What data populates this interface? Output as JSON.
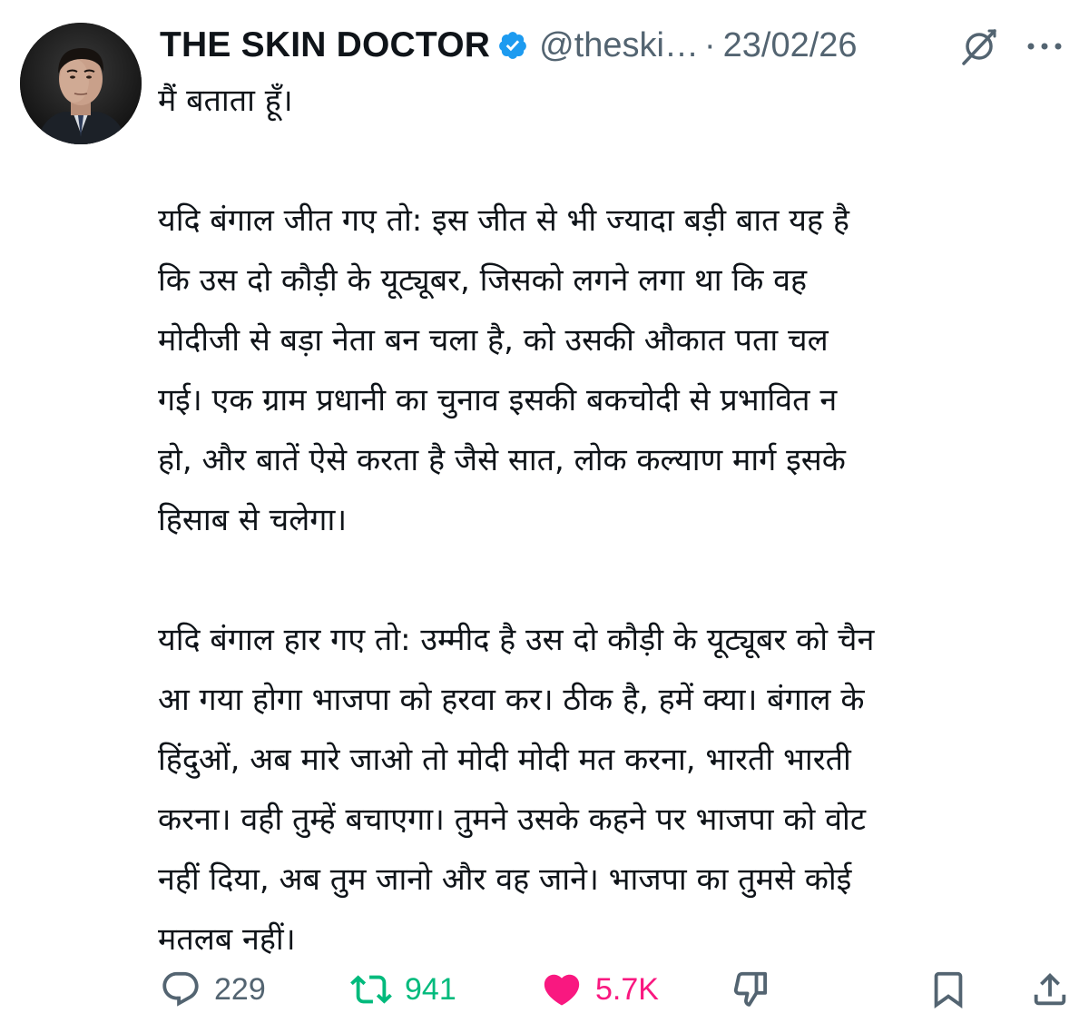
{
  "author": {
    "display_name": "THE SKIN DOCTOR",
    "handle": "@theski…",
    "separator": "·",
    "date": "23/02/26",
    "verified_icon": "verified-badge-icon",
    "verified_color": "#1d9bf0"
  },
  "tweet": {
    "paragraphs": [
      "मैं बताता हूँ।",
      "",
      "यदि बंगाल जीत गए तो: इस जीत से भी ज्यादा बड़ी बात यह है\nकि उस दो कौड़ी के यूट्यूबर, जिसको लगने लगा था कि वह\nमोदीजी से बड़ा नेता बन चला है, को उसकी औकात पता चल\nगई। एक ग्राम प्रधानी का चुनाव इसकी बकचोदी से प्रभावित न\nहो, और बातें ऐसे करता है जैसे सात, लोक कल्याण मार्ग इसके\nहिसाब से चलेगा।",
      "",
      "यदि बंगाल हार गए तो: उम्मीद है उस दो कौड़ी के यूट्यूबर को चैन\nआ गया होगा भाजपा को हरवा कर। ठीक है, हमें क्या। बंगाल के\nहिंदुओं, अब मारे जाओ तो मोदी मोदी मत करना, भारती भारती\nकरना। वही तुम्हें बचाएगा। तुमने उसके कहने पर भाजपा को वोट\nनहीं दिया, अब तुम जानो और वह जाने। भाजपा का तुमसे कोई\nमतलब नहीं।"
    ]
  },
  "actions": {
    "reply": {
      "icon": "reply-icon",
      "count": "229",
      "color": "#536471"
    },
    "retweet": {
      "icon": "retweet-icon",
      "count": "941",
      "color": "#00ba7c"
    },
    "like": {
      "icon": "heart-filled-icon",
      "count": "5.7K",
      "color": "#f91880"
    },
    "dislike": {
      "icon": "thumbs-down-icon"
    },
    "bookmark": {
      "icon": "bookmark-icon"
    },
    "share": {
      "icon": "share-icon"
    }
  },
  "header_icons": [
    "grok-icon",
    "more-icon"
  ]
}
